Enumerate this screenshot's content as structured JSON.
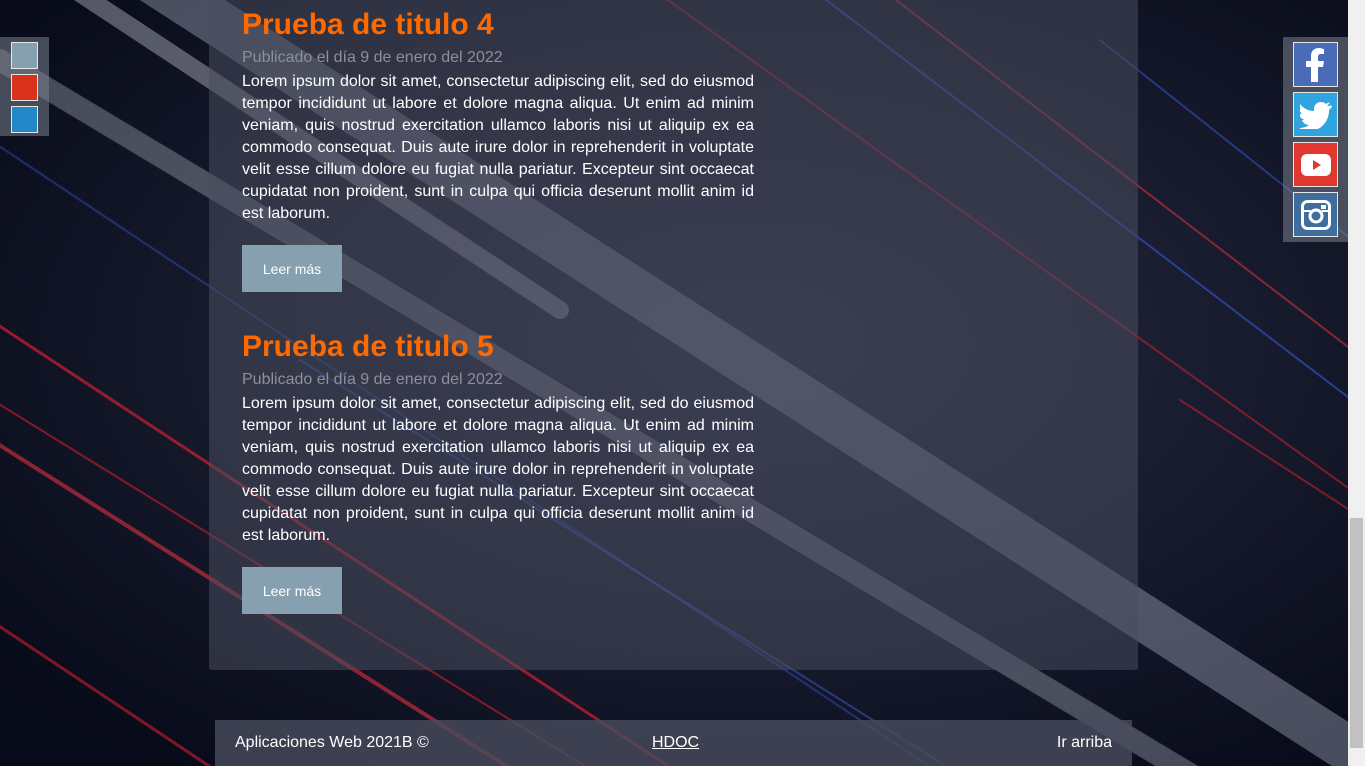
{
  "posts": [
    {
      "title": "Prueba de titulo 4",
      "date": "Publicado el día 9 de enero del 2022",
      "body": "Lorem ipsum dolor sit amet, consectetur adipiscing elit, sed do eiusmod tempor incididunt ut labore et dolore magna aliqua. Ut enim ad minim veniam, quis nostrud exercitation ullamco laboris nisi ut aliquip ex ea commodo consequat. Duis aute irure dolor in reprehenderit in voluptate velit esse cillum dolore eu fugiat nulla pariatur. Excepteur sint occaecat cupidatat non proident, sunt in culpa qui officia deserunt mollit anim id est laborum.",
      "button": "Leer más"
    },
    {
      "title": "Prueba de titulo 5",
      "date": "Publicado el día 9 de enero del 2022",
      "body": "Lorem ipsum dolor sit amet, consectetur adipiscing elit, sed do eiusmod tempor incididunt ut labore et dolore magna aliqua. Ut enim ad minim veniam, quis nostrud exercitation ullamco laboris nisi ut aliquip ex ea commodo consequat. Duis aute irure dolor in reprehenderit in voluptate velit esse cillum dolore eu fugiat nulla pariatur. Excepteur sint occaecat cupidatat non proident, sunt in culpa qui officia deserunt mollit anim id est laborum.",
      "button": "Leer más"
    }
  ],
  "theme_swatches": [
    {
      "name": "gray-blue",
      "color": "#86a0b0"
    },
    {
      "name": "red",
      "color": "#d9341b"
    },
    {
      "name": "blue",
      "color": "#2388c8"
    }
  ],
  "social": [
    {
      "icon": "facebook-icon",
      "color": "#4a6bb8"
    },
    {
      "icon": "twitter-icon",
      "color": "#2fa4e0"
    },
    {
      "icon": "youtube-icon",
      "color": "#e0382e"
    },
    {
      "icon": "instagram-icon",
      "color": "#3d6e9e"
    }
  ],
  "footer": {
    "copyright": "Aplicaciones Web 2021B ©",
    "center_link": "HDOC",
    "top_link": "Ir arriba"
  },
  "colors": {
    "title": "#ff6a00",
    "button": "#86a0b0"
  }
}
